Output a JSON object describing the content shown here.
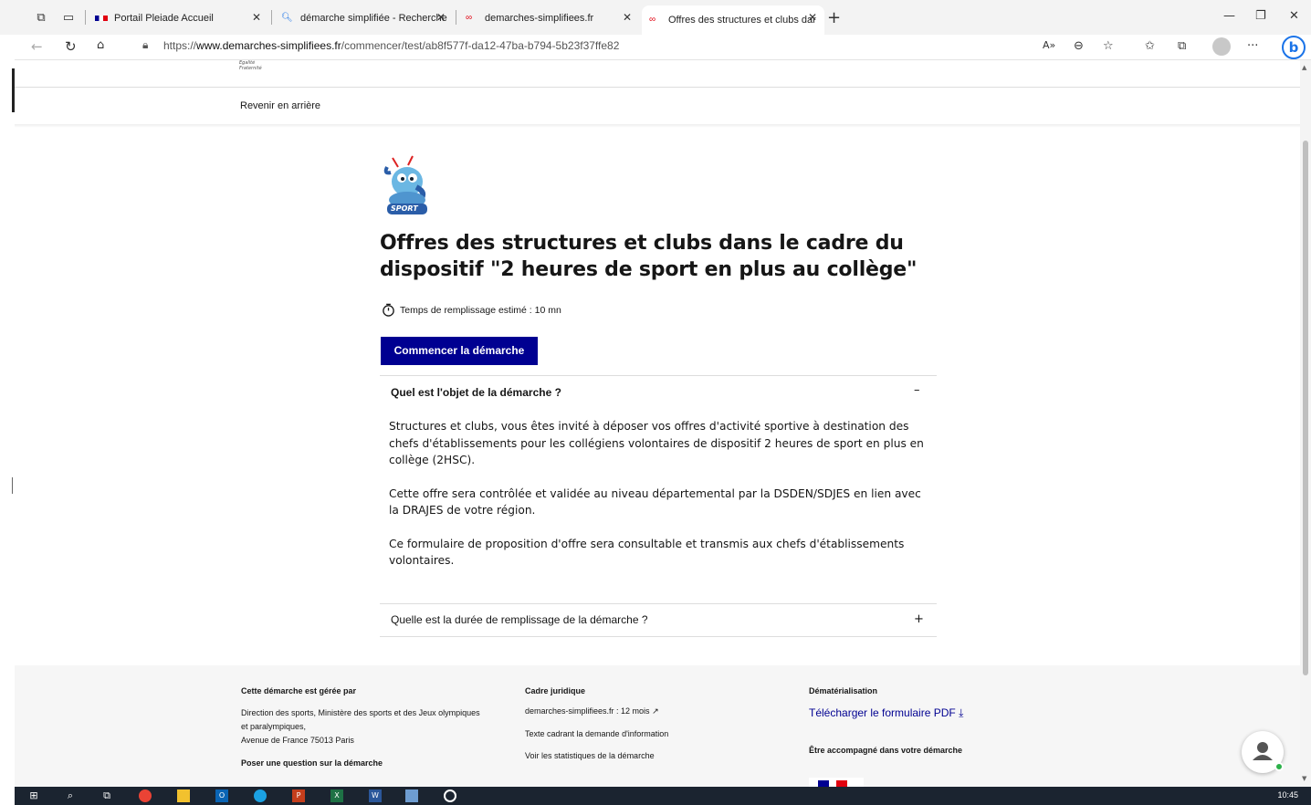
{
  "browser": {
    "tabs": [
      {
        "title": "Portail Pleiade Accueil",
        "active": false
      },
      {
        "title": "démarche simplifiée - Recherche",
        "active": false
      },
      {
        "title": "demarches-simplifiees.fr",
        "active": false
      },
      {
        "title": "Offres des structures et clubs dar",
        "active": true
      }
    ],
    "url_prefix": "https://",
    "url_domain": "www.demarches-simplifiees.fr",
    "url_path": "/commencer/test/ab8f577f-da12-47ba-b794-5b23f37ffe82"
  },
  "header": {
    "logo_caption": "Égalité\nFraternité",
    "back_link": "Revenir en arrière"
  },
  "main": {
    "title": "Offres des structures et clubs dans le cadre du dispositif \"2 heures de sport en plus au collège\"",
    "duration": "Temps de remplissage estimé : 10 mn",
    "start_button": "Commencer la démarche",
    "accordion": [
      {
        "question": "Quel est l'objet de la démarche ?",
        "open": true,
        "toggle": "–",
        "paragraphs": [
          "Structures et clubs, vous êtes invité à déposer vos offres d'activité sportive à destination des chefs d'établissements pour les collégiens volontaires de dispositif 2 heures de sport en plus en collège (2HSC).",
          "Cette offre sera contrôlée et validée au niveau départemental par la DSDEN/SDJES en lien avec la DRAJES de votre région.",
          "Ce formulaire de proposition d'offre sera consultable et transmis aux chefs d'établissements volontaires."
        ]
      },
      {
        "question": "Quelle est la durée de remplissage de la démarche ?",
        "open": false,
        "toggle": "+"
      }
    ]
  },
  "footer": {
    "managed_by": {
      "heading": "Cette démarche est gérée par",
      "line1": "Direction des sports, Ministère des sports et des Jeux olympiques",
      "line2": "et paralympiques,",
      "line3": "Avenue de France 75013 Paris",
      "question_heading": "Poser une question sur la démarche"
    },
    "legal": {
      "heading": "Cadre juridique",
      "link1": "demarches-simplifiees.fr : 12 mois",
      "link2": "Texte cadrant la demande d'information",
      "link3": "Voir les statistiques de la démarche"
    },
    "dematerialisation": {
      "heading": "Dématérialisation",
      "pdf_link": "Télécharger le formulaire PDF",
      "accompany_heading": "Être accompagné dans votre démarche"
    }
  },
  "taskbar": {
    "clock": "10:45"
  },
  "colors": {
    "primary": "#000091",
    "text": "#161616",
    "footer_bg": "#f6f6f6"
  }
}
